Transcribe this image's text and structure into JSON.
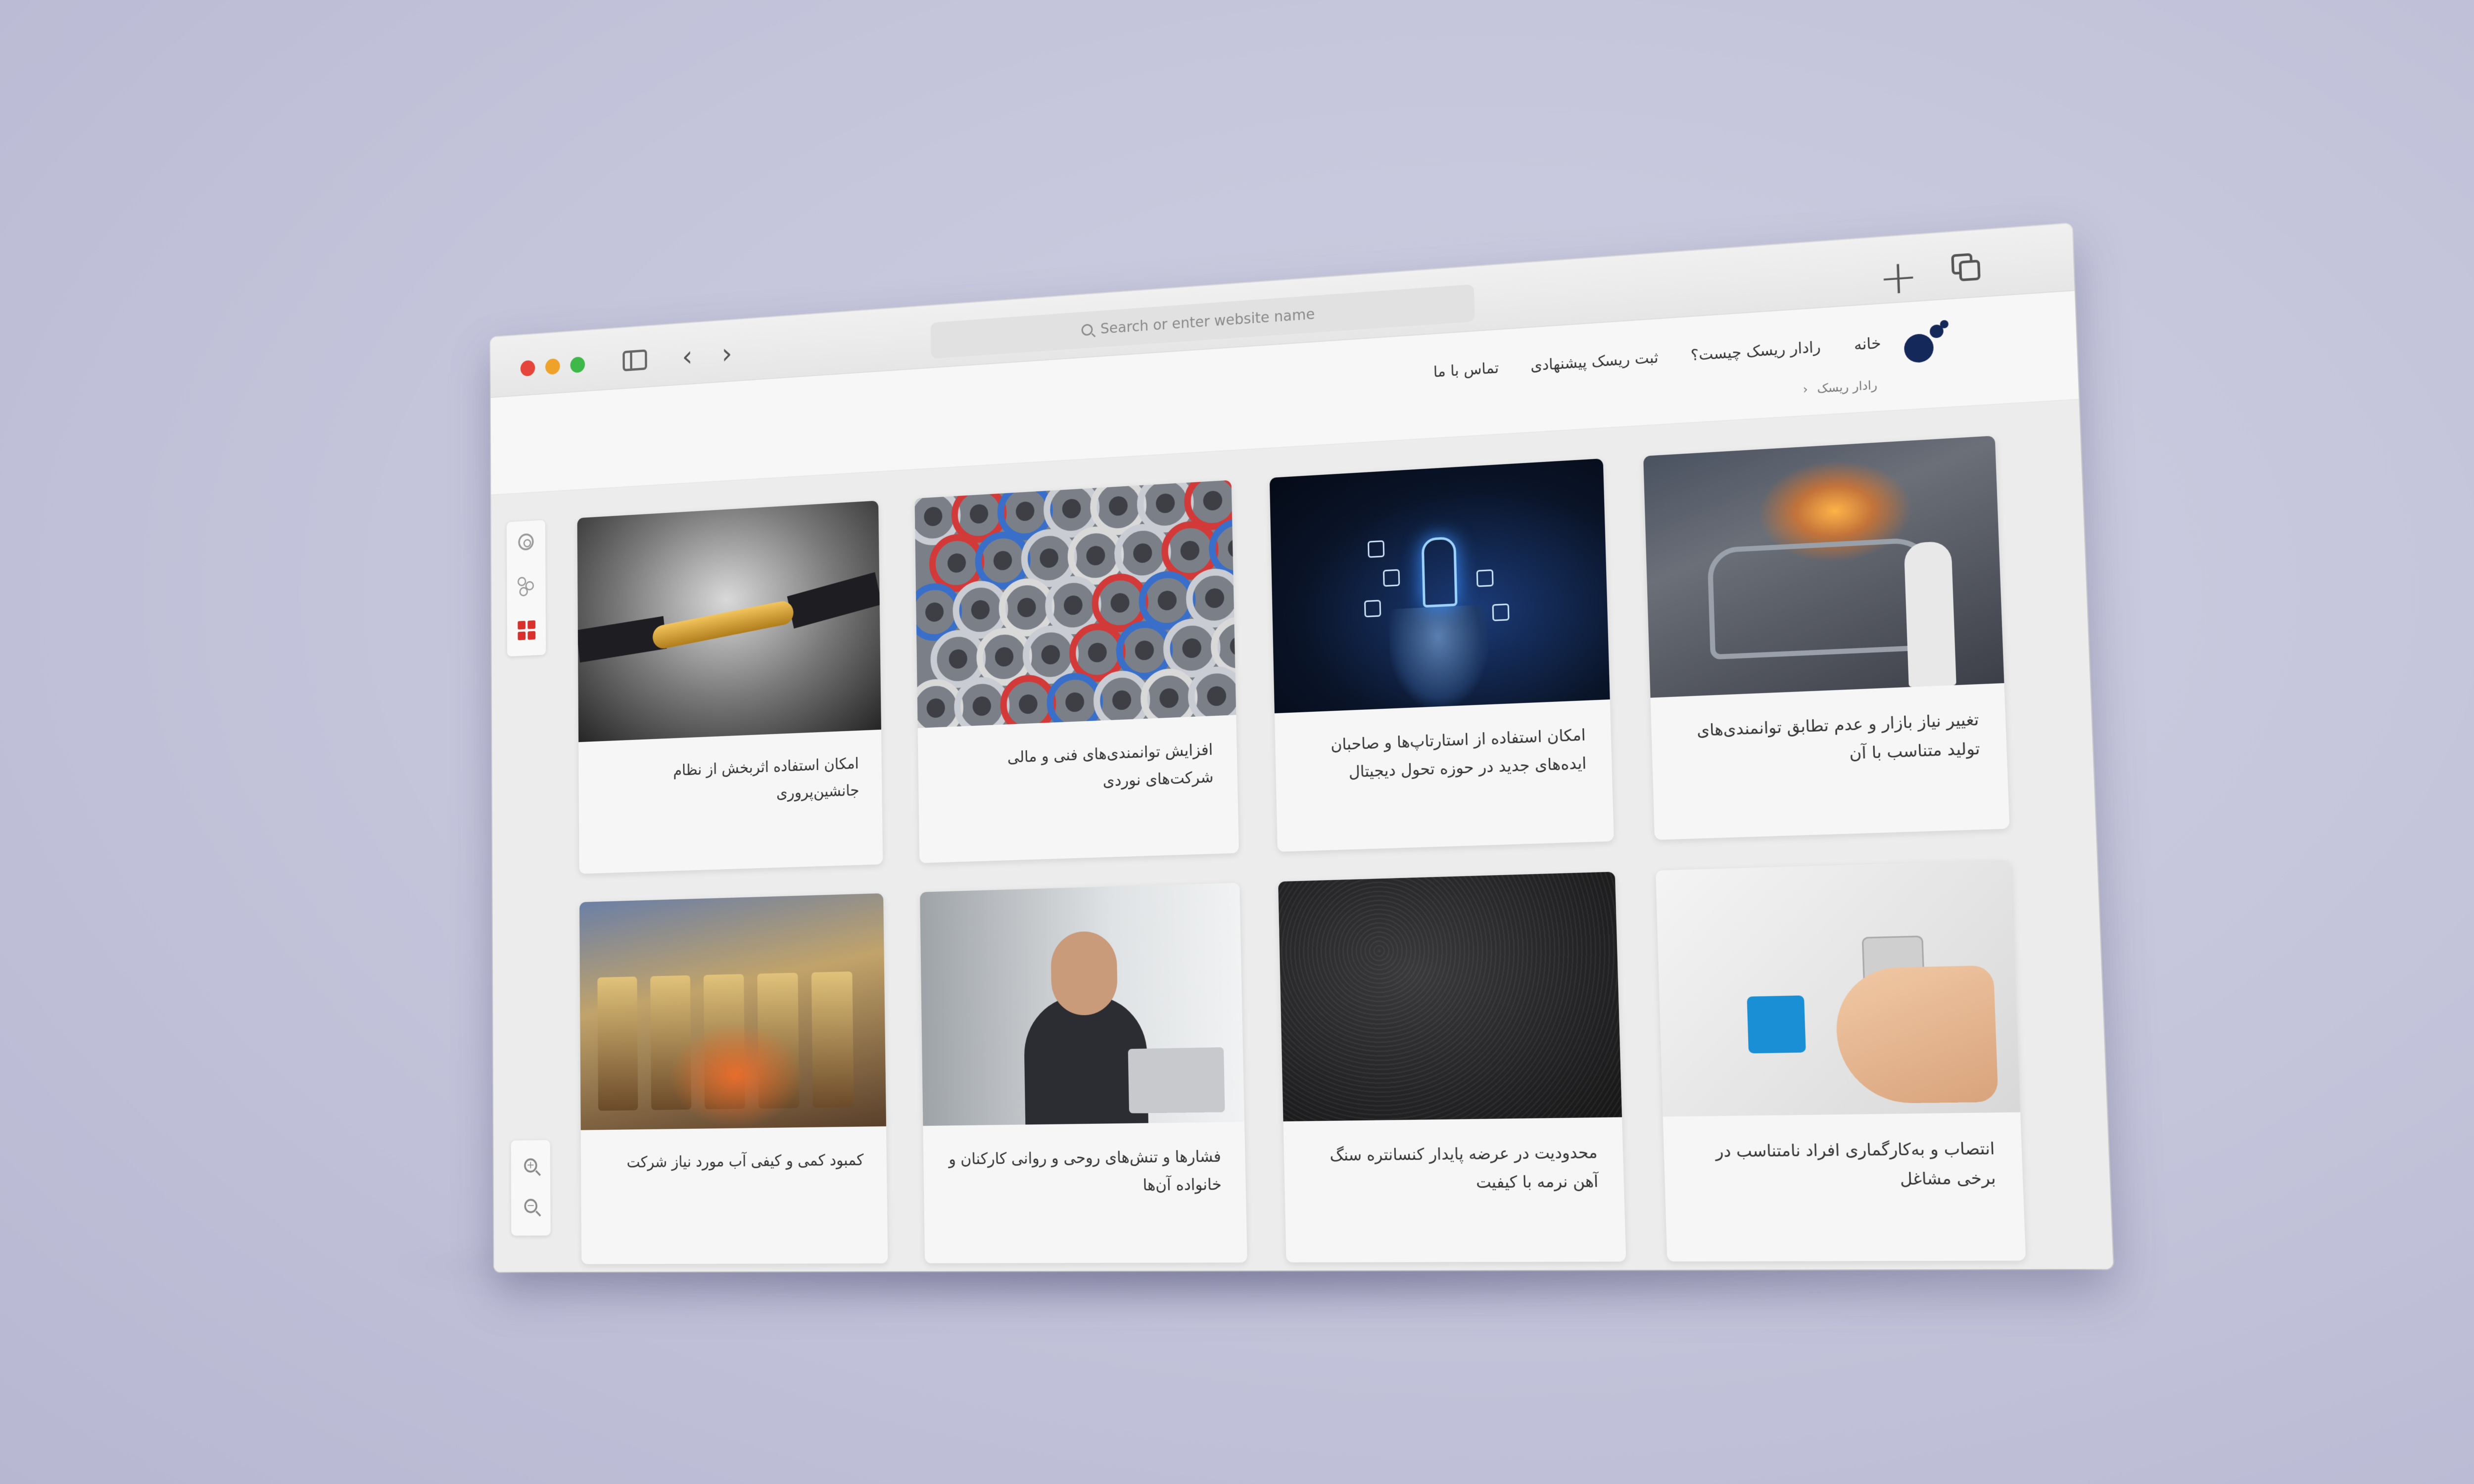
{
  "browser": {
    "address_placeholder": "Search or enter website name"
  },
  "site": {
    "nav": [
      "خانه",
      "رادار ریسک چیست؟",
      "ثبت ریسک پیشنهادی",
      "تماس با ما"
    ],
    "breadcrumb": "رادار ریسک"
  },
  "cards": [
    {
      "caption": "تغییر نیاز بازار و عدم تطابق توانمندی‌های تولید متناسب با آن"
    },
    {
      "caption": "امکان استفاده از استارتاپ‌ها و صاحبان ایده‌های جدید در حوزه تحول دیجیتال"
    },
    {
      "caption": "افزایش توانمندی‌های فنی و مالی شرکت‌های نوردی"
    },
    {
      "caption": "امکان استفاده اثربخش از نظام جانشین‌پروری"
    },
    {
      "caption": "انتصاب و به‌کارگماری افراد نامتناسب در برخی مشاغل"
    },
    {
      "caption": "محدودیت در عرضه پایدار کنسانتره سنگ آهن نرمه با کیفیت"
    },
    {
      "caption": "فشارها و تنش‌های روحی و روانی کارکنان و خانواده آن‌ها"
    },
    {
      "caption": "کمبود کمی و کیفی آب مورد نیاز شرکت"
    }
  ],
  "colors": {
    "accent_red": "#d9302c",
    "logo_navy": "#15285a"
  }
}
